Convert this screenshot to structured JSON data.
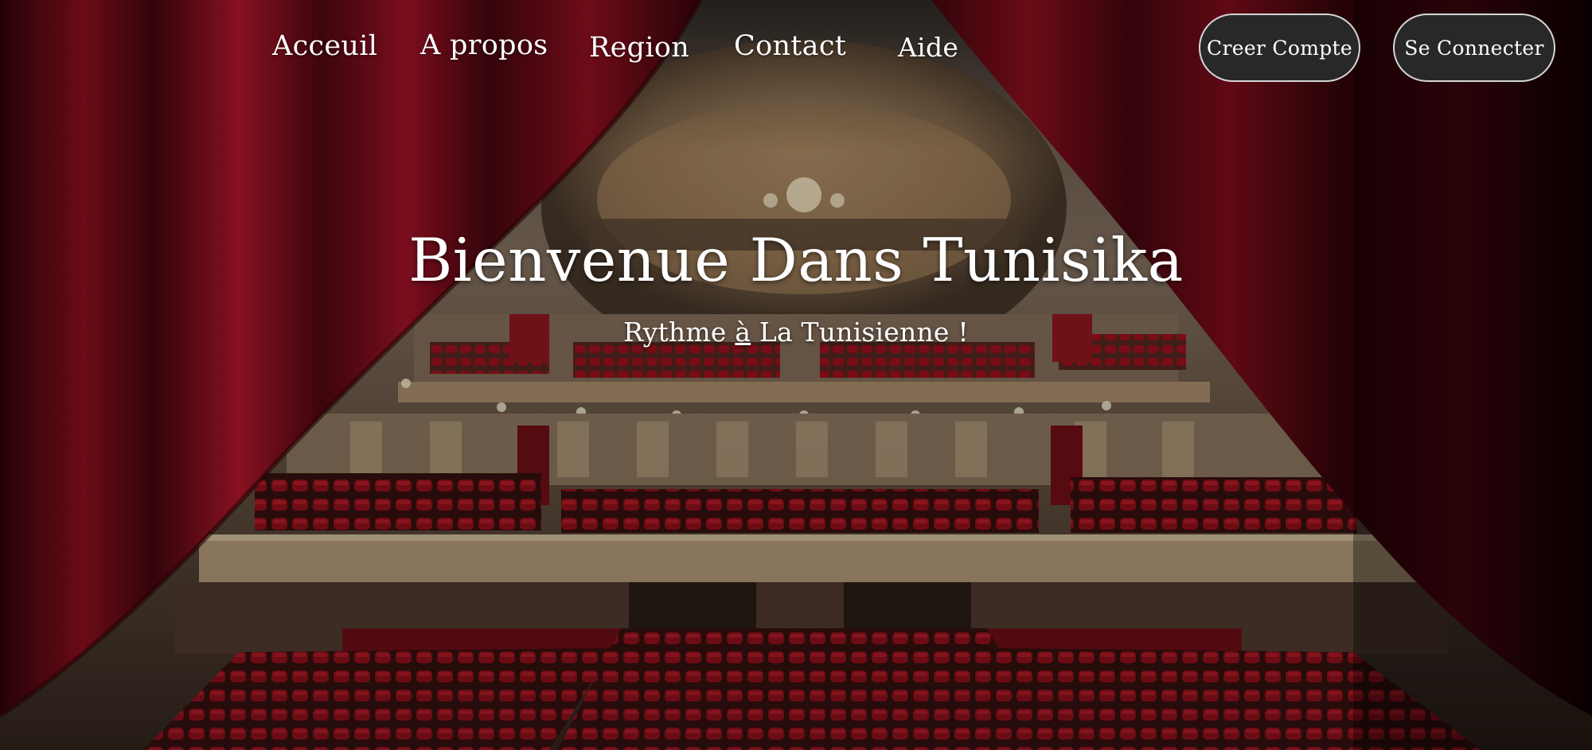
{
  "nav": {
    "links": [
      {
        "label": "Acceuil"
      },
      {
        "label": "A propos"
      },
      {
        "label": "Region"
      },
      {
        "label": "Contact"
      },
      {
        "label": "Aide"
      }
    ],
    "signup_label": "Creer Compte",
    "login_label": "Se Connecter"
  },
  "hero": {
    "title": "Bienvenue Dans Tunisika",
    "subtitle_before": "Rythme ",
    "subtitle_link": "à",
    "subtitle_after": " La Tunisienne !"
  },
  "colors": {
    "curtain": "#8c0f1f",
    "seat": "#a8121f",
    "button_bg": "#282828",
    "button_border": "#d6d6d6",
    "text": "#ffffff"
  }
}
